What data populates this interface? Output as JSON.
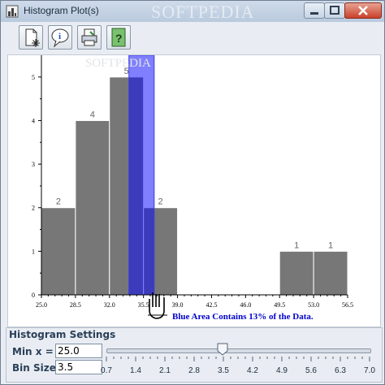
{
  "window": {
    "title": "Histogram Plot(s)",
    "watermark": "SOFTPEDIA"
  },
  "toolbar": {
    "buttons": [
      {
        "name": "new-plot-button",
        "icon": "new-document-icon"
      },
      {
        "name": "info-button",
        "icon": "info-icon"
      },
      {
        "name": "print-button",
        "icon": "print-icon"
      },
      {
        "name": "help-button",
        "icon": "help-icon"
      }
    ]
  },
  "chart_data": {
    "type": "bar",
    "bins": [
      {
        "start": 25.0,
        "end": 28.5,
        "count": 2
      },
      {
        "start": 28.5,
        "end": 32.0,
        "count": 4
      },
      {
        "start": 32.0,
        "end": 35.5,
        "count": 5
      },
      {
        "start": 35.5,
        "end": 39.0,
        "count": 2
      },
      {
        "start": 39.0,
        "end": 42.5,
        "count": 0
      },
      {
        "start": 42.5,
        "end": 46.0,
        "count": 0
      },
      {
        "start": 46.0,
        "end": 49.5,
        "count": 0
      },
      {
        "start": 49.5,
        "end": 53.0,
        "count": 1
      },
      {
        "start": 53.0,
        "end": 56.5,
        "count": 1
      }
    ],
    "x_ticks": [
      "25.0",
      "28.5",
      "32.0",
      "35.5",
      "39.0",
      "42.5",
      "46.0",
      "49.5",
      "53.0",
      "56.5"
    ],
    "y_ticks": [
      "0",
      "1",
      "2",
      "3",
      "4",
      "5"
    ],
    "xlim": [
      25.0,
      56.5
    ],
    "ylim": [
      0,
      5.5
    ],
    "bar_color": "#777777",
    "highlight": {
      "from": 34.0,
      "to": 36.6,
      "color": "#0000ff",
      "opacity": 0.5
    },
    "annotation": "Blue Area Contains 13% of the Data.",
    "annotation_color": "#0000cc",
    "watermark": "SOFTPEDIA"
  },
  "settings": {
    "title": "Histogram Settings",
    "min_x_label": "Min x =",
    "min_x_value": "25.0",
    "bin_size_label": "Bin Size =",
    "bin_size_value": "3.5",
    "slider_ticks": [
      "0.7",
      "1.4",
      "2.1",
      "2.8",
      "3.5",
      "4.2",
      "4.9",
      "5.6",
      "6.3",
      "7.0"
    ],
    "slider_value": 3.5
  }
}
